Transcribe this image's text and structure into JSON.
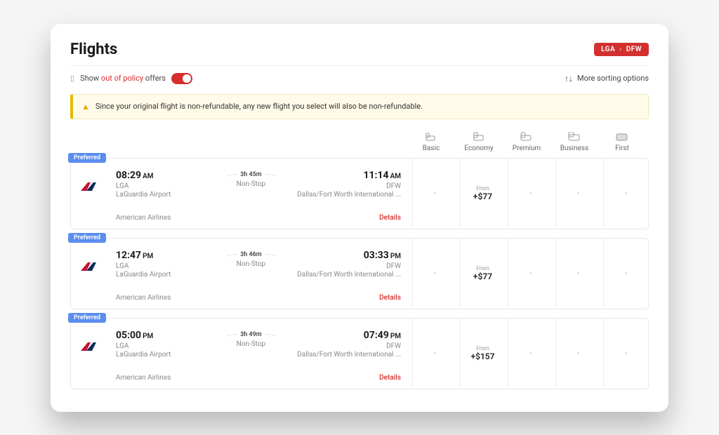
{
  "header": {
    "title": "Flights",
    "route_from": "LGA",
    "route_to": "DFW"
  },
  "controls": {
    "show_prefix": "Show ",
    "show_highlight": "out of policy",
    "show_suffix": " offers",
    "sort_label": "More sorting options"
  },
  "alert": {
    "message": "Since your original flight is non-refundable, any new flight you select will also be non-refundable."
  },
  "fare_classes": [
    "Basic",
    "Economy",
    "Premium",
    "Business",
    "First"
  ],
  "flights": [
    {
      "preferred": "Preferred",
      "dep_time": "08:29",
      "dep_ampm": "AM",
      "dep_code": "LGA",
      "dep_airport": "LaGuardia Airport",
      "duration": "3h 45m",
      "stops": "Non-Stop",
      "arr_time": "11:14",
      "arr_ampm": "AM",
      "arr_code": "DFW",
      "arr_airport": "Dallas/Fort Worth International ...",
      "airline": "American Airlines",
      "details": "Details",
      "prices": {
        "basic": "-",
        "economy_from": "From",
        "economy": "+$77",
        "premium": "-",
        "business": "-",
        "first": "-"
      }
    },
    {
      "preferred": "Preferred",
      "dep_time": "12:47",
      "dep_ampm": "PM",
      "dep_code": "LGA",
      "dep_airport": "LaGuardia Airport",
      "duration": "3h 46m",
      "stops": "Non-Stop",
      "arr_time": "03:33",
      "arr_ampm": "PM",
      "arr_code": "DFW",
      "arr_airport": "Dallas/Fort Worth International ...",
      "airline": "American Airlines",
      "details": "Details",
      "prices": {
        "basic": "-",
        "economy_from": "From",
        "economy": "+$77",
        "premium": "-",
        "business": "-",
        "first": "-"
      }
    },
    {
      "preferred": "Preferred",
      "dep_time": "05:00",
      "dep_ampm": "PM",
      "dep_code": "LGA",
      "dep_airport": "LaGuardia Airport",
      "duration": "3h 49m",
      "stops": "Non-Stop",
      "arr_time": "07:49",
      "arr_ampm": "PM",
      "arr_code": "DFW",
      "arr_airport": "Dallas/Fort Worth International ...",
      "airline": "American Airlines",
      "details": "Details",
      "prices": {
        "basic": "-",
        "economy_from": "From",
        "economy": "+$157",
        "premium": "-",
        "business": "-",
        "first": "-"
      }
    }
  ]
}
